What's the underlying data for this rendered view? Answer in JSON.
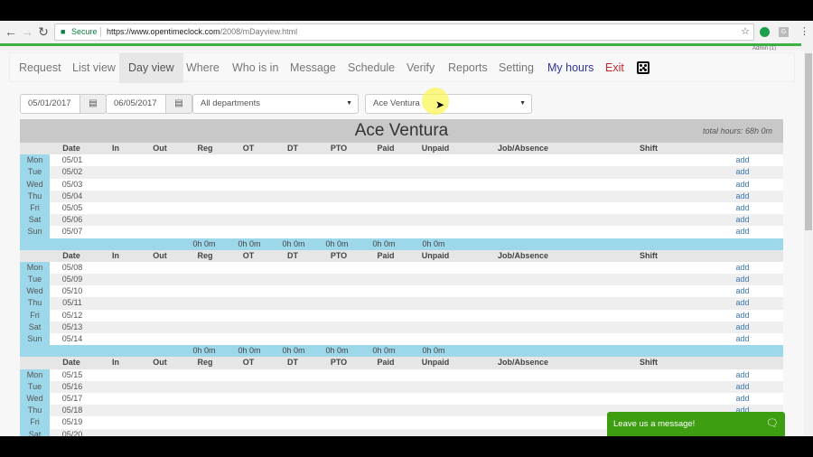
{
  "browser": {
    "secure_label": "Secure",
    "url_host": "https://www.opentimeclock.com",
    "url_path": "/2008/mDayview.html",
    "ext_g_label": "G",
    "admin_label": "Admin (1)"
  },
  "nav": {
    "items": [
      {
        "label": "Request"
      },
      {
        "label": "List view"
      },
      {
        "label": "Day view",
        "active": true
      },
      {
        "label": "Where"
      },
      {
        "label": "Who is in"
      },
      {
        "label": "Message"
      },
      {
        "label": "Schedule"
      },
      {
        "label": "Verify"
      },
      {
        "label": "Reports"
      },
      {
        "label": "Setting"
      },
      {
        "label": "My hours"
      },
      {
        "label": "Exit"
      }
    ],
    "extra_icon": "dice-icon"
  },
  "filters": {
    "start_date": "05/01/2017",
    "end_date": "06/05/2017",
    "department": "All departments",
    "employee": "Ace Ventura"
  },
  "report": {
    "employee_name": "Ace Ventura",
    "total_hours": "total hours: 68h 0m",
    "columns": [
      "Date",
      "In",
      "Out",
      "Reg",
      "OT",
      "DT",
      "PTO",
      "Paid",
      "Unpaid",
      "Job/Absence",
      "Shift"
    ],
    "add_label": "add",
    "weeks": [
      {
        "days": [
          {
            "day": "Mon",
            "date": "05/01"
          },
          {
            "day": "Tue",
            "date": "05/02"
          },
          {
            "day": "Wed",
            "date": "05/03"
          },
          {
            "day": "Thu",
            "date": "05/04"
          },
          {
            "day": "Fri",
            "date": "05/05"
          },
          {
            "day": "Sat",
            "date": "05/06"
          },
          {
            "day": "Sun",
            "date": "05/07"
          }
        ],
        "totals": {
          "Reg": "0h 0m",
          "OT": "0h 0m",
          "DT": "0h 0m",
          "PTO": "0h 0m",
          "Paid": "0h 0m",
          "Unpaid": "0h 0m"
        }
      },
      {
        "days": [
          {
            "day": "Mon",
            "date": "05/08"
          },
          {
            "day": "Tue",
            "date": "05/09"
          },
          {
            "day": "Wed",
            "date": "05/10"
          },
          {
            "day": "Thu",
            "date": "05/11"
          },
          {
            "day": "Fri",
            "date": "05/12"
          },
          {
            "day": "Sat",
            "date": "05/13"
          },
          {
            "day": "Sun",
            "date": "05/14"
          }
        ],
        "totals": {
          "Reg": "0h 0m",
          "OT": "0h 0m",
          "DT": "0h 0m",
          "PTO": "0h 0m",
          "Paid": "0h 0m",
          "Unpaid": "0h 0m"
        }
      },
      {
        "days": [
          {
            "day": "Mon",
            "date": "05/15"
          },
          {
            "day": "Tue",
            "date": "05/16"
          },
          {
            "day": "Wed",
            "date": "05/17"
          },
          {
            "day": "Thu",
            "date": "05/18"
          },
          {
            "day": "Fri",
            "date": "05/19"
          },
          {
            "day": "Sat",
            "date": "05/20"
          }
        ]
      }
    ]
  },
  "chat": {
    "label": "Leave us a message!"
  }
}
